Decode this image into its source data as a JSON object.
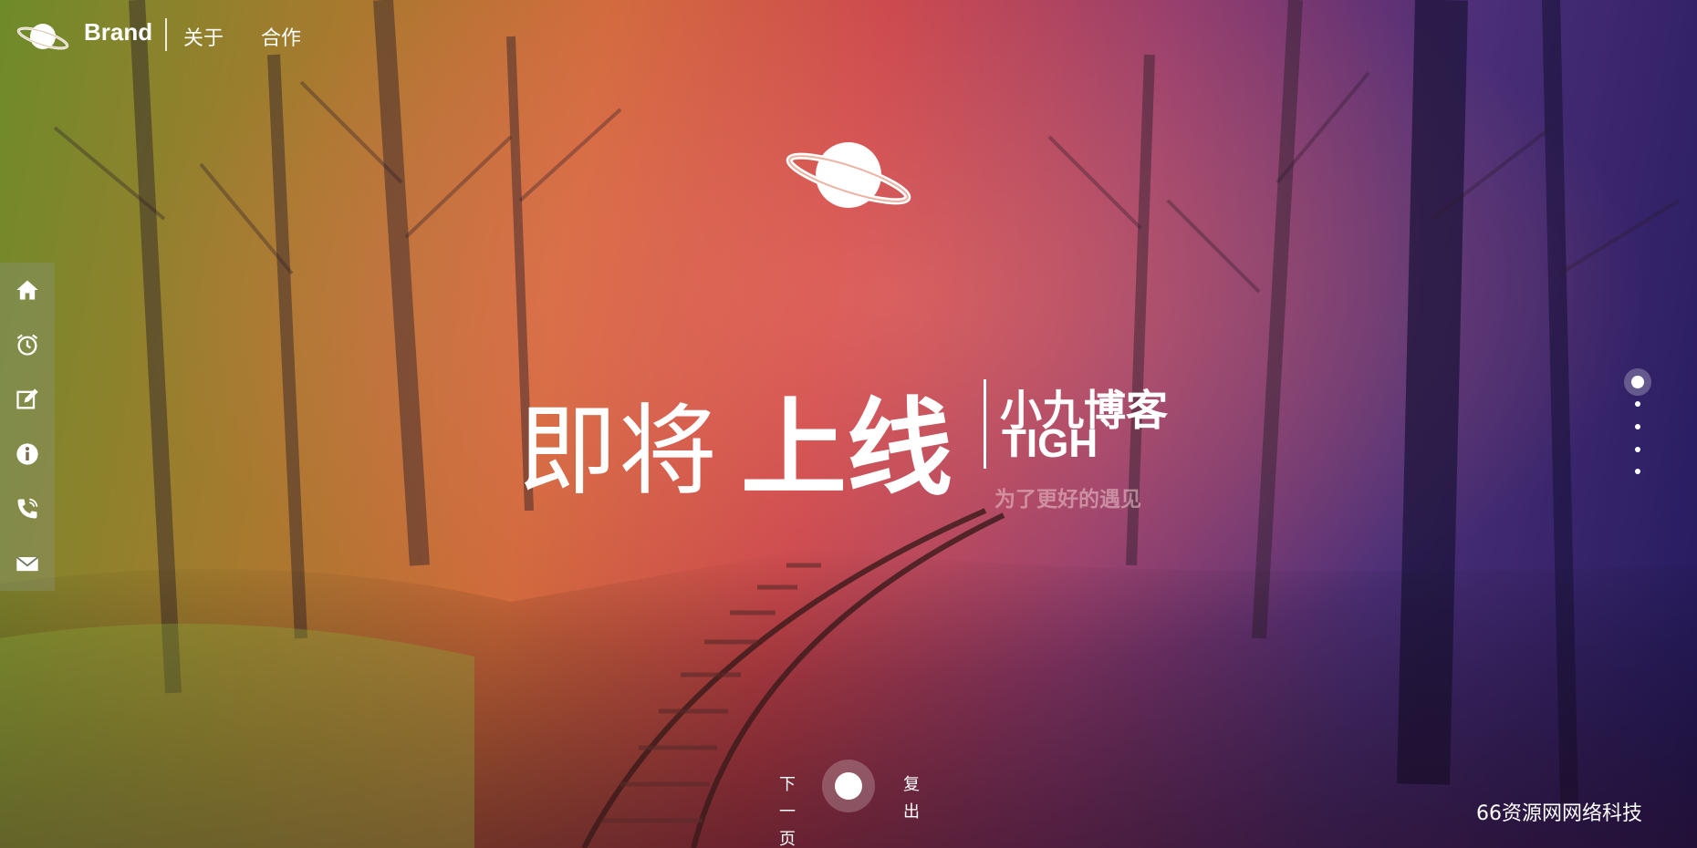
{
  "header": {
    "brand_name": "Brand",
    "nav": [
      {
        "label": "关于"
      },
      {
        "label": "合作"
      }
    ]
  },
  "sidebar": {
    "items": [
      {
        "icon": "home-icon"
      },
      {
        "icon": "alarm-clock-icon"
      },
      {
        "icon": "edit-icon"
      },
      {
        "icon": "info-icon"
      },
      {
        "icon": "phone-icon"
      },
      {
        "icon": "mail-icon"
      }
    ]
  },
  "main": {
    "headline_light": "即将",
    "headline_bold": "上线",
    "blog_name": "小九博客",
    "blog_code": "TIGH",
    "tagline": "为了更好的遇见"
  },
  "pager": {
    "total": 5,
    "active": 1
  },
  "controls": {
    "next_label": [
      "下",
      "一",
      "页"
    ],
    "exit_label": [
      "复",
      "出"
    ]
  },
  "footer": {
    "company": "66资源网网络科技"
  },
  "colors": {
    "accent": "#ffffff",
    "bg_left": "#6e8b2a",
    "bg_center": "#c8434a",
    "bg_right": "#241a5e"
  }
}
